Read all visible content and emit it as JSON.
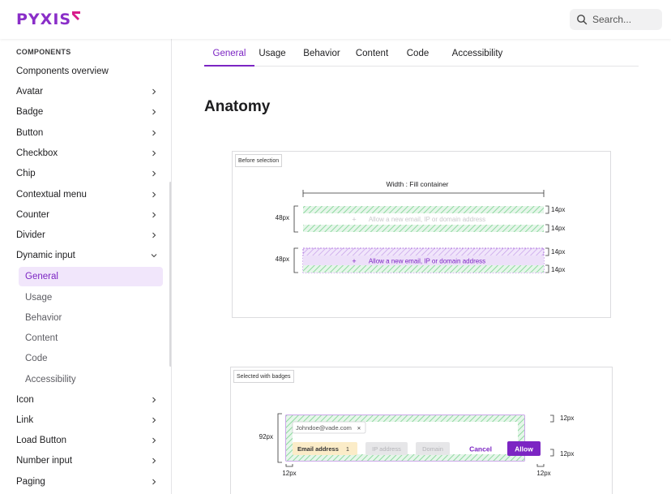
{
  "brand": {
    "logo_text": "PYXIS",
    "color": "#8a2ec8"
  },
  "search": {
    "placeholder": "Search...",
    "icon": "search-icon"
  },
  "sidebar": {
    "section_title": "COMPONENTS",
    "overview": "Components overview",
    "items_top": [
      "Avatar",
      "Badge",
      "Button",
      "Checkbox",
      "Chip",
      "Contextual menu",
      "Counter",
      "Divider"
    ],
    "expanded": "Dynamic input",
    "subitems": [
      "General",
      "Usage",
      "Behavior",
      "Content",
      "Code",
      "Accessibility"
    ],
    "active_subitem": "General",
    "items_bottom": [
      "Icon",
      "Link",
      "Load Button",
      "Number input",
      "Paging"
    ]
  },
  "tabs": [
    "General",
    "Usage",
    "Behavior",
    "Content",
    "Code",
    "Accessibility"
  ],
  "active_tab": "General",
  "page_title": "Anatomy",
  "figure1": {
    "tag": "Before selection",
    "width_label": "Width : Fill container",
    "height_label": "48px",
    "padding_label": "14px",
    "field_text": "Allow a new email, IP or domain address"
  },
  "figure2": {
    "tag": "Selected with badges",
    "height_label": "92px",
    "padding_label": "12px",
    "chip_text": "Johndoe@vade.com",
    "chip_close": "×",
    "tabs": [
      "Email address",
      "IP address",
      "Domain"
    ],
    "count": "1",
    "cancel_label": "Cancel",
    "allow_label": "Allow"
  },
  "colors": {
    "accent": "#7c25c3",
    "accent_light": "#f1e6fb",
    "spacing_green": "#8fd9a0"
  }
}
